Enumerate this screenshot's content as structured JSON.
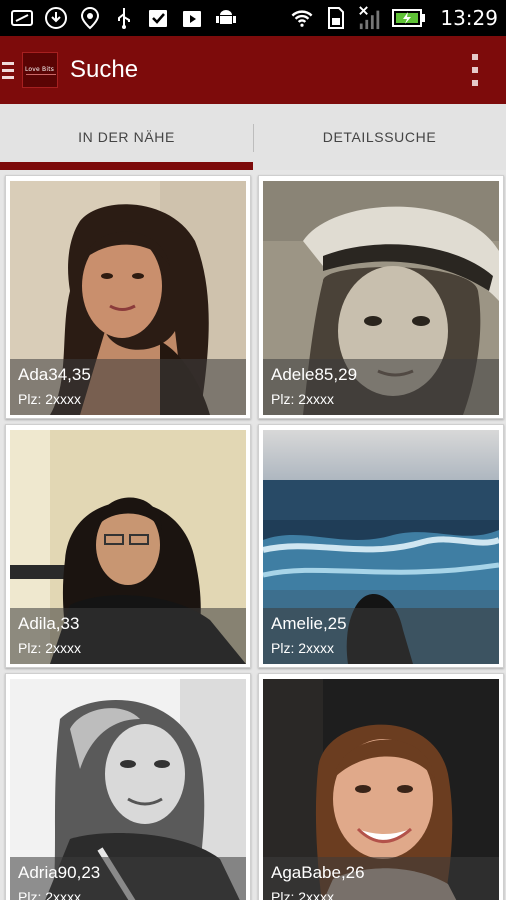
{
  "status_bar": {
    "time": "13:29",
    "left_icons": [
      "message-icon",
      "download-icon",
      "location-icon",
      "usb-icon",
      "check-icon",
      "play-store-icon",
      "android-debug-icon"
    ],
    "right_icons": [
      "wifi-icon",
      "sim-icon",
      "no-signal-icon",
      "battery-charging-icon"
    ]
  },
  "action_bar": {
    "title": "Suche",
    "logo_text": "Love Bits",
    "color": "#7d0b0b"
  },
  "tabs": [
    {
      "label": "IN DER NÄHE",
      "selected": true
    },
    {
      "label": "DETAILSSUCHE",
      "selected": false
    }
  ],
  "profiles": [
    {
      "name": "Ada34,35",
      "plz": "Plz: 2xxxx"
    },
    {
      "name": "Adele85,29",
      "plz": "Plz: 2xxxx"
    },
    {
      "name": "Adila,33",
      "plz": "Plz: 2xxxx"
    },
    {
      "name": "Amelie,25",
      "plz": "Plz: 2xxxx"
    },
    {
      "name": "Adria90,23",
      "plz": "Plz: 2xxxx"
    },
    {
      "name": "AgaBabe,26",
      "plz": "Plz: 2xxxx"
    }
  ]
}
